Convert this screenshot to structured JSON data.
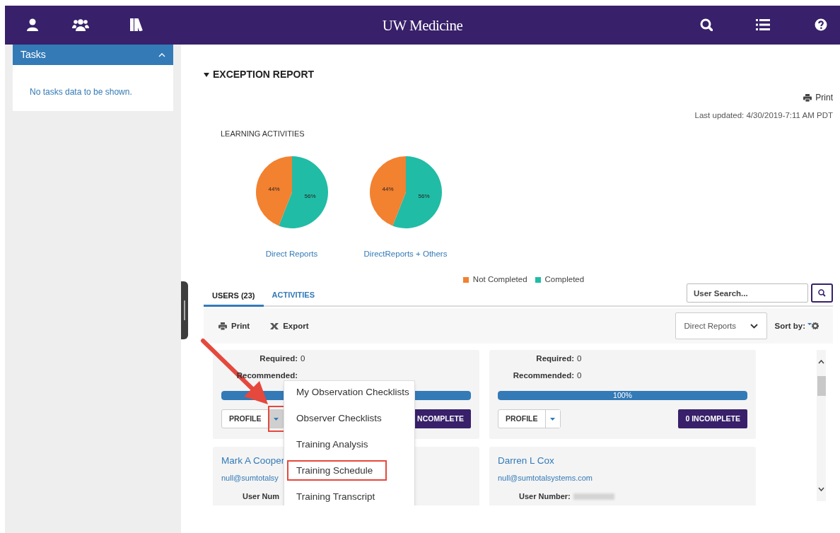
{
  "header": {
    "title": "UW Medicine"
  },
  "tasks_panel": {
    "title": "Tasks",
    "expanded": true,
    "message": "No tasks data to be shown."
  },
  "report": {
    "title": "EXCEPTION REPORT",
    "expanded": true,
    "print": "Print",
    "last_updated": "Last updated: 4/30/2019-7:11 AM PDT",
    "section_title": "LEARNING ACTIVITIES",
    "charts": [
      {
        "caption": "Direct Reports",
        "chart_data": {
          "type": "pie",
          "values": [
            44,
            56
          ],
          "value_labels": [
            "44%",
            "56%"
          ]
        }
      },
      {
        "caption": "DirectReports + Others",
        "chart_data": {
          "type": "pie",
          "values": [
            44,
            56
          ],
          "value_labels": [
            "44%",
            "56%"
          ]
        }
      }
    ],
    "legend": [
      {
        "label": "Not Completed",
        "color": "#f28130"
      },
      {
        "label": "Completed",
        "color": "#21bca5"
      }
    ]
  },
  "tabs": [
    {
      "label": "USERS (23)",
      "selected": true
    },
    {
      "label": "ACTIVITIES",
      "selected": false
    }
  ],
  "user_search": {
    "placeholder": "User Search..."
  },
  "toolbar": {
    "print": "Print",
    "export": "Export",
    "filter": "Direct Reports",
    "sort_label": "Sort by:"
  },
  "cards": [
    {
      "kind": "summary",
      "fields": [
        {
          "label": "Required:",
          "value": "0"
        },
        {
          "label": "Recommended:"
        }
      ],
      "level": 1,
      "profile": "PROFILE",
      "menu_open": true,
      "caret_annotated": true,
      "incomplete": "NCOMPLETE"
    },
    {
      "kind": "summary",
      "fields": [
        {
          "label": "Required:",
          "value": "0"
        },
        {
          "label": "Recommended:",
          "value": "0"
        }
      ],
      "level": 1,
      "progress_label": "100%",
      "profile": "PROFILE",
      "menu_open": false,
      "caret_annotated": false,
      "incomplete": "0 INCOMPLETE"
    },
    {
      "kind": "contact",
      "name": "Mark A Cooper",
      "email": "null@sumtotalsy",
      "fields": [
        {
          "label": "User Num"
        }
      ]
    },
    {
      "kind": "contact",
      "name": "Darren L Cox",
      "email": "null@sumtotalsystems.com",
      "fields": [
        {
          "label": "User Number:",
          "redacted": true
        }
      ]
    }
  ],
  "profile_menu": {
    "items": [
      {
        "label": "My Observation Checklists",
        "annotated": false
      },
      {
        "label": "Observer Checklists",
        "annotated": false
      },
      {
        "label": "Training Analysis",
        "annotated": false
      },
      {
        "label": "Training Schedule",
        "annotated": true
      },
      {
        "label": "Training Transcript",
        "annotated": false
      }
    ]
  }
}
